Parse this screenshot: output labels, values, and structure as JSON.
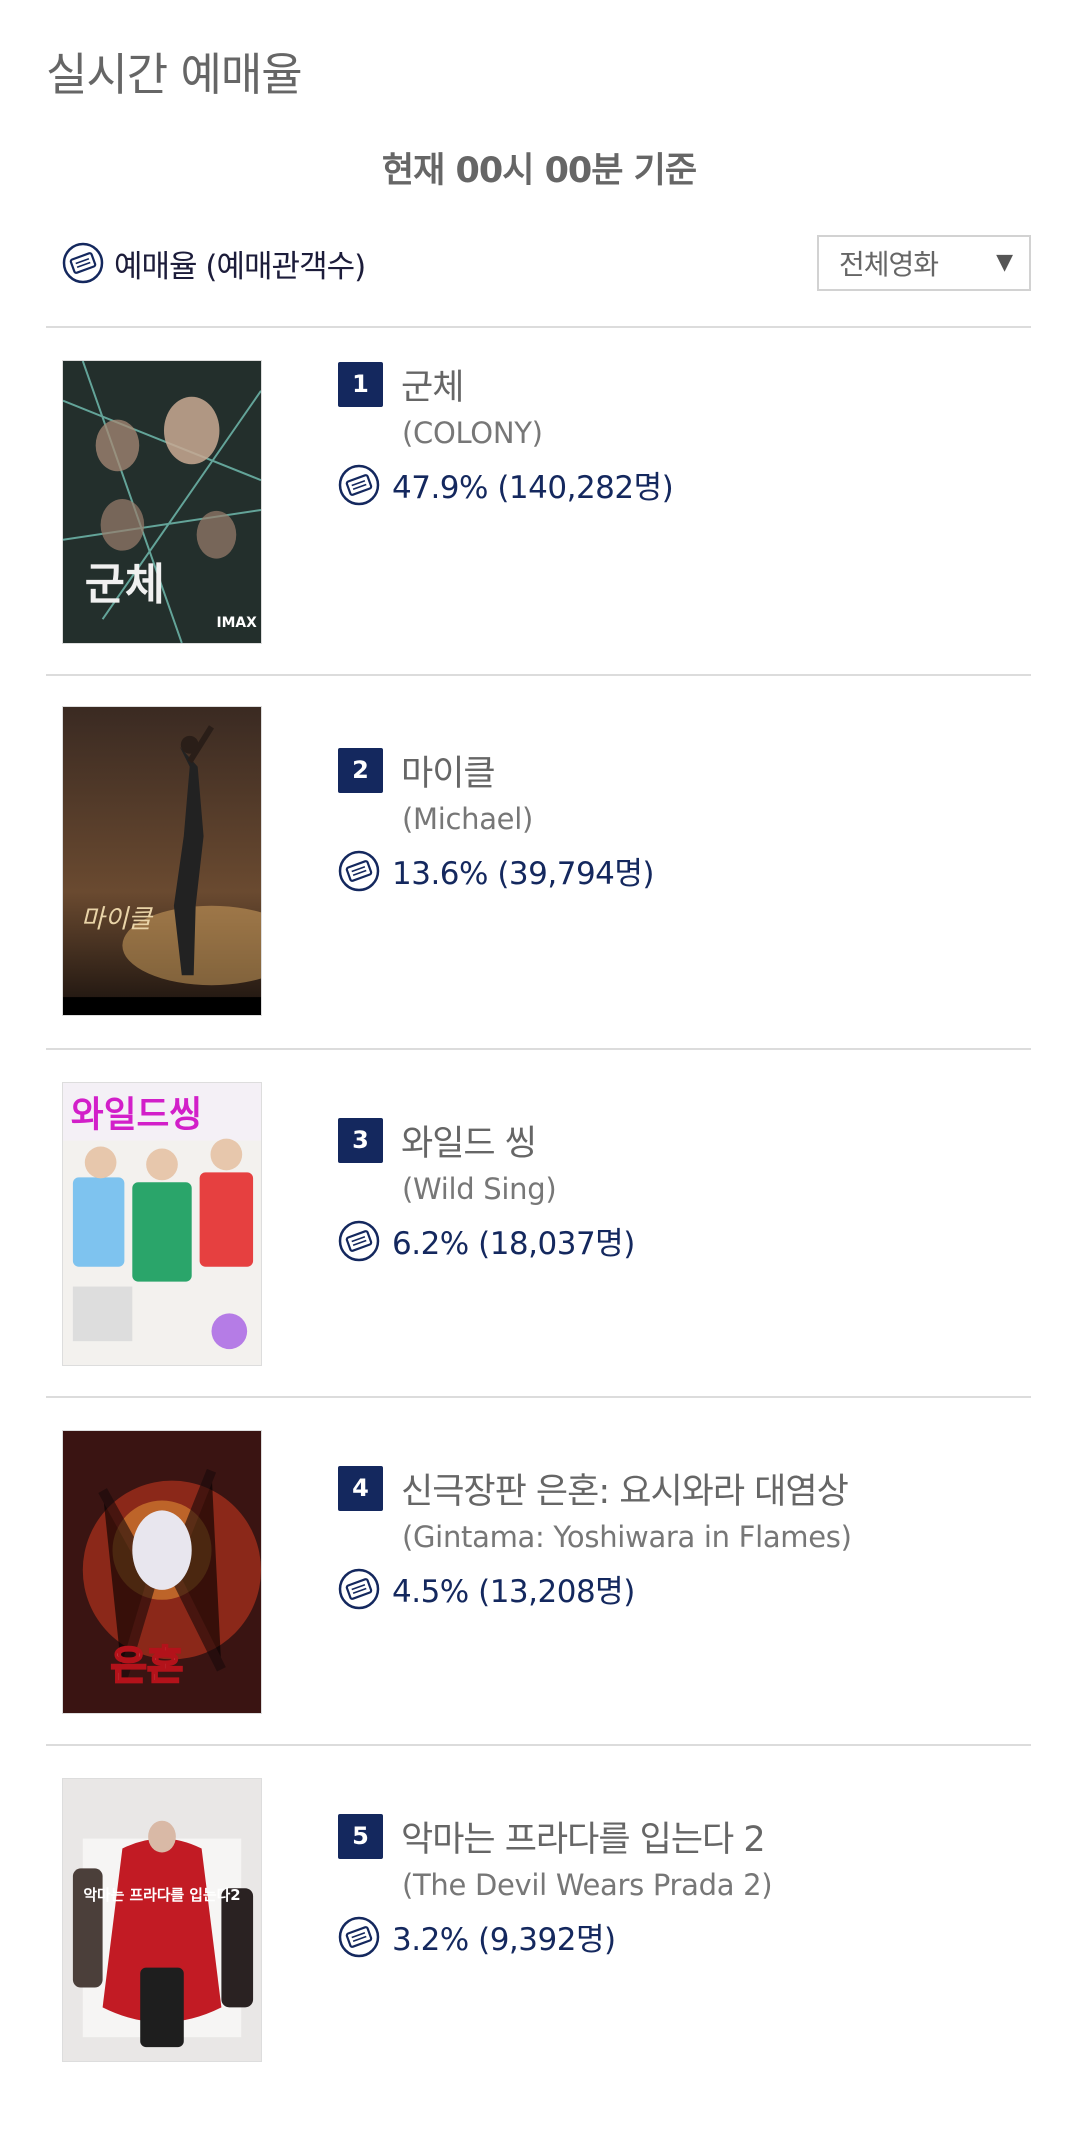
{
  "header": {
    "title": "실시간 예매율",
    "basis": "현재  00시 00분   기준"
  },
  "legend": {
    "label": "예매율 (예매관객수)",
    "icon": "ticket-icon"
  },
  "filter": {
    "selected": "전체영화",
    "arrow": "▼"
  },
  "colors": {
    "rank_badge": "#14285e",
    "rate_text": "#14285e",
    "divider": "#dcdcdc"
  },
  "movies": [
    {
      "rank": "1",
      "title": "군체",
      "english_title": "(COLONY)",
      "rate": "47.9% (140,282명)",
      "poster_text": "군체",
      "poster_badge": "IMAX"
    },
    {
      "rank": "2",
      "title": "마이클",
      "english_title": "(Michael)",
      "rate": "13.6% (39,794명)",
      "poster_text": "마이클"
    },
    {
      "rank": "3",
      "title": "와일드 씽",
      "english_title": "(Wild Sing)",
      "rate": "6.2% (18,037명)",
      "poster_text": "와일드씽"
    },
    {
      "rank": "4",
      "title": "신극장판 은혼: 요시와라 대염상",
      "english_title": "(Gintama: Yoshiwara in Flames)",
      "rate": "4.5% (13,208명)",
      "poster_text": "은혼"
    },
    {
      "rank": "5",
      "title": "악마는 프라다를 입는다 2",
      "english_title": "(The Devil Wears Prada 2)",
      "rate": "3.2% (9,392명)",
      "poster_text": "악마는 프라다를 입는다2"
    }
  ]
}
